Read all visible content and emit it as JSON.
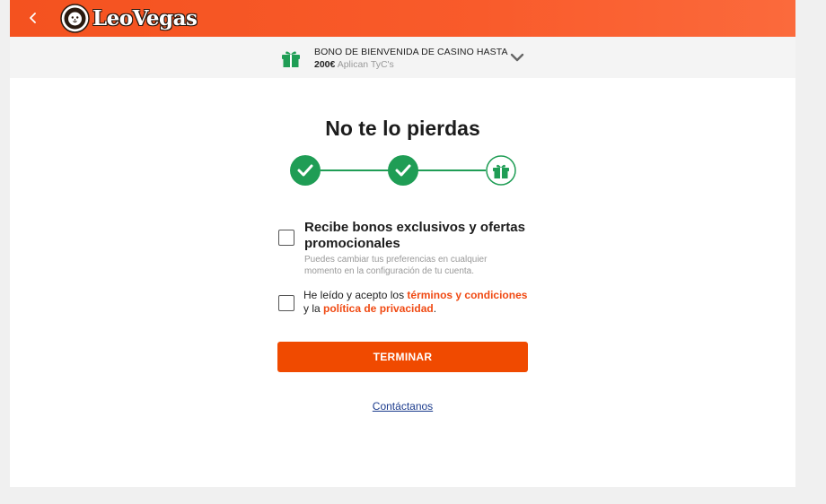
{
  "header": {
    "brand_name": "LeoVegas",
    "brand_color": "#f4521f"
  },
  "promo": {
    "title": "BONO DE BIENVENIDA DE CASINO HASTA",
    "amount": "200€",
    "terms": "Aplican TyC's",
    "icon": "gift-icon",
    "accent_color": "#1f9d55"
  },
  "main": {
    "heading": "No te lo pierdas",
    "steps": [
      {
        "state": "completed",
        "icon": "check-icon"
      },
      {
        "state": "completed",
        "icon": "check-icon"
      },
      {
        "state": "current",
        "icon": "gift-icon"
      }
    ],
    "option_promotions": {
      "title": "Recibe bonos exclusivos y ofertas promocionales",
      "description": "Puedes cambiar tus preferencias en cualquier momento en la configuración de tu cuenta.",
      "checked": false
    },
    "option_terms": {
      "text_before": "He leído y acepto los ",
      "terms_link": "términos y condiciones",
      "text_middle": " y la ",
      "privacy_link": "política de privacidad",
      "text_after": ".",
      "checked": false
    },
    "finish_button": "TERMINAR",
    "contact_link": "Contáctanos"
  }
}
